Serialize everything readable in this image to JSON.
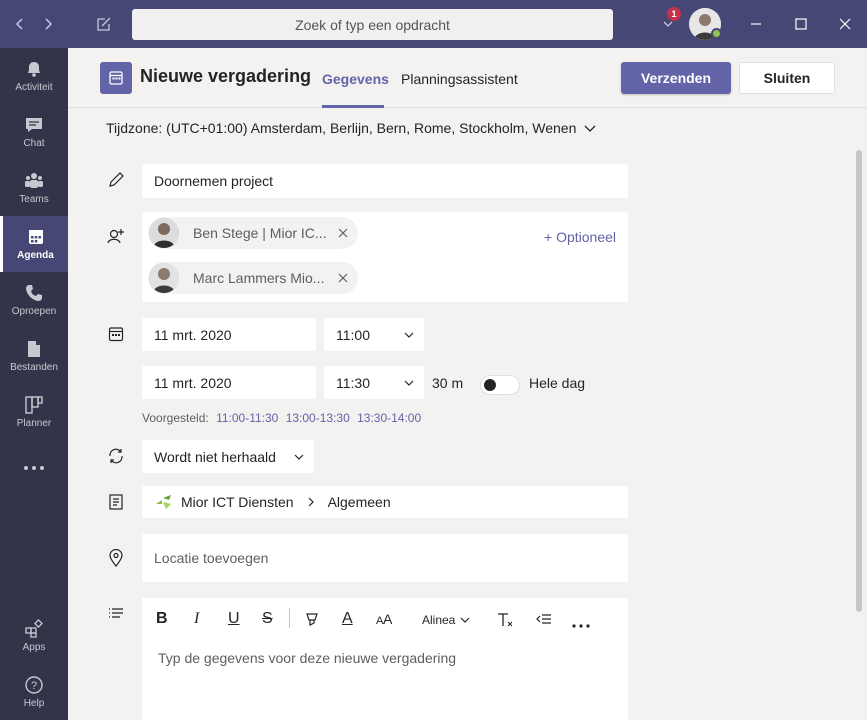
{
  "titlebar": {
    "search_placeholder": "Zoek of typ een opdracht",
    "notification_count": "1"
  },
  "rail": {
    "items": [
      {
        "label": "Activiteit",
        "icon": "bell-icon"
      },
      {
        "label": "Chat",
        "icon": "chat-icon"
      },
      {
        "label": "Teams",
        "icon": "teams-icon"
      },
      {
        "label": "Agenda",
        "icon": "calendar-icon"
      },
      {
        "label": "Oproepen",
        "icon": "phone-icon"
      },
      {
        "label": "Bestanden",
        "icon": "file-icon"
      },
      {
        "label": "Planner",
        "icon": "planner-icon"
      },
      {
        "label": "Apps",
        "icon": "apps-icon"
      },
      {
        "label": "Help",
        "icon": "help-icon"
      }
    ]
  },
  "header": {
    "title": "Nieuwe vergadering",
    "tabs": [
      {
        "label": "Gegevens"
      },
      {
        "label": "Planningsassistent"
      }
    ],
    "send_label": "Verzenden",
    "close_label": "Sluiten"
  },
  "timezone": "Tijdzone: (UTC+01:00) Amsterdam, Berlijn, Bern, Rome, Stockholm, Wenen",
  "form": {
    "title_value": "Doornemen project",
    "attendees": [
      {
        "name": "Ben Stege | Mior IC..."
      },
      {
        "name": "Marc Lammers Mio..."
      }
    ],
    "optional_label": "+ Optioneel",
    "start_date": "11 mrt. 2020",
    "start_time": "11:00",
    "end_date": "11 mrt. 2020",
    "end_time": "11:30",
    "duration": "30 m",
    "all_day_label": "Hele dag",
    "suggested_label": "Voorgesteld:",
    "suggested_slots": [
      "11:00-11:30",
      "13:00-13:30",
      "13:30-14:00"
    ],
    "repeat_value": "Wordt niet herhaald",
    "channel_team": "Mior ICT Diensten",
    "channel_name": "Algemeen",
    "location_placeholder": "Locatie toevoegen",
    "editor": {
      "paragraph_label": "Alinea",
      "placeholder": "Typ de gegevens voor deze nieuwe vergadering"
    }
  },
  "colors": {
    "accent": "#6264a7",
    "titlebar": "#464775",
    "rail": "#33344a"
  }
}
